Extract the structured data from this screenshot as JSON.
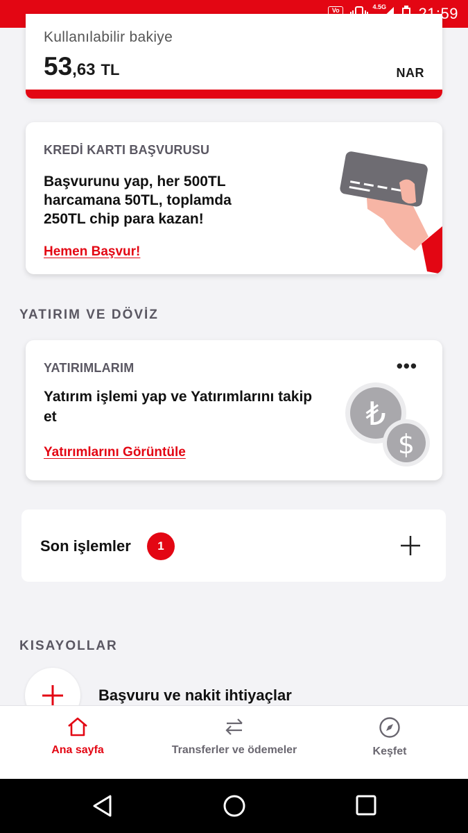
{
  "status_bar": {
    "volte": "Vo LTE",
    "network": "4.5G",
    "time": "21:59"
  },
  "balance": {
    "label": "Kullanılabilir bakiye",
    "amount_int": "53",
    "amount_dec": ",63",
    "currency": "TL",
    "account_name": "NAR"
  },
  "credit_card_promo": {
    "kicker": "KREDİ KARTI BAŞVURUSU",
    "body": "Başvurunu yap, her 500TL harcamana 50TL, toplamda 250TL chip para kazan!",
    "link": "Hemen Başvur!",
    "illustration": "hand-holding-card-illustration"
  },
  "invest_section": {
    "title": "YATIRIM VE DÖVİZ",
    "card": {
      "kicker": "YATIRIMLARIM",
      "more_label": "•••",
      "body": "Yatırım işlemi yap ve Yatırımlarını takip et",
      "link": "Yatırımlarını Görüntüle",
      "illustration": "lira-dollar-coins-illustration"
    }
  },
  "recent_transactions": {
    "title": "Son işlemler",
    "count": "1",
    "icon": "plus-icon"
  },
  "shortcuts": {
    "title": "KISAYOLLAR",
    "items": [
      {
        "label": "Başvuru ve nakit ihtiyaçlar",
        "icon": "plus-icon"
      }
    ]
  },
  "bottom_nav": {
    "items": [
      {
        "label": "Ana sayfa",
        "icon": "home-icon",
        "active": true
      },
      {
        "label": "Transferler ve ödemeler",
        "icon": "transfer-arrows-icon",
        "active": false
      },
      {
        "label": "Keşfet",
        "icon": "compass-icon",
        "active": false
      }
    ]
  },
  "colors": {
    "brand_red": "#e30613",
    "background": "#f3f3f6",
    "muted_text": "#5a5762"
  }
}
